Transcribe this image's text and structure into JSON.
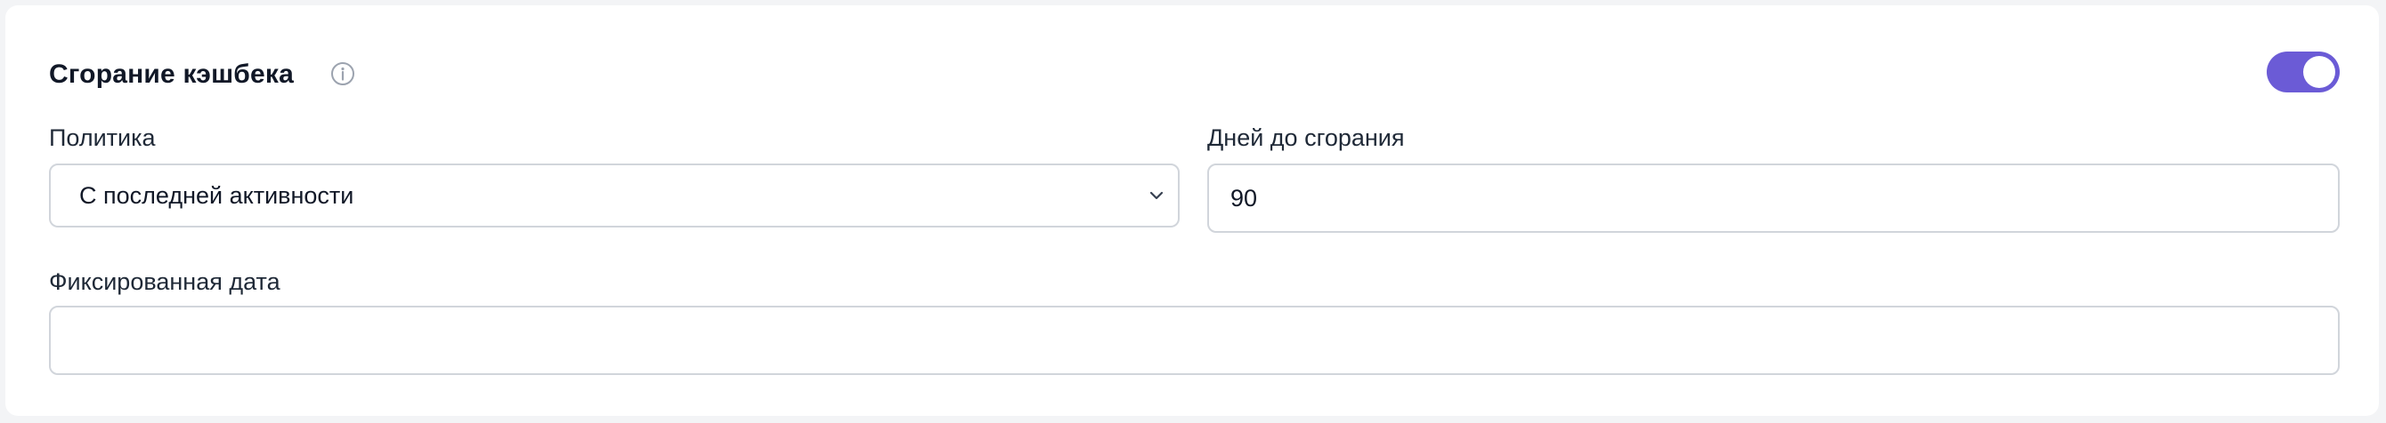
{
  "section": {
    "title": "Сгорание кэшбека",
    "enabled": true
  },
  "policy": {
    "label": "Политика",
    "selected": "С последней активности"
  },
  "days": {
    "label": "Дней до сгорания",
    "value": "90"
  },
  "fixed_date": {
    "label": "Фиксированная дата",
    "value": ""
  },
  "icons": {
    "info": "info-icon",
    "chevron": "chevron-down-icon"
  },
  "colors": {
    "accent": "#6b5bd6",
    "border": "#d1d5db"
  }
}
